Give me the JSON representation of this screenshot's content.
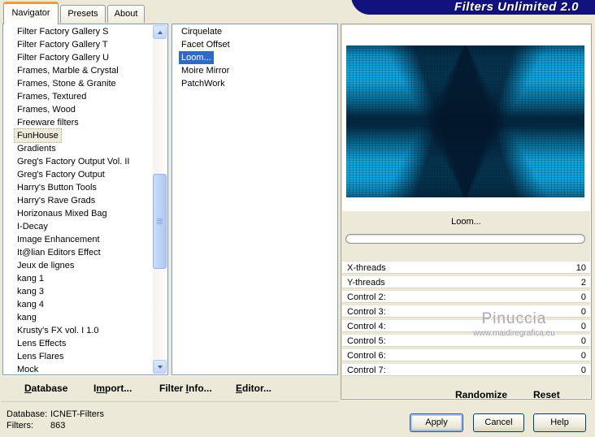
{
  "window": {
    "banner_title": "Filters Unlimited 2.0"
  },
  "tabs": [
    "Navigator",
    "Presets",
    "About"
  ],
  "category_list": {
    "selected_index": 8,
    "items": [
      "Filter Factory Gallery S",
      "Filter Factory Gallery T",
      "Filter Factory Gallery U",
      "Frames, Marble & Crystal",
      "Frames, Stone & Granite",
      "Frames, Textured",
      "Frames, Wood",
      "Freeware filters",
      "FunHouse",
      "Gradients",
      "Greg's Factory Output Vol. II",
      "Greg's Factory Output",
      "Harry's Button Tools",
      "Harry's Rave Grads",
      "Horizonaus Mixed Bag",
      "I-Decay",
      "Image Enhancement",
      "It@lian Editors Effect",
      "Jeux de lignes",
      "kang 1",
      "kang 3",
      "kang 4",
      "kang",
      "Krusty's FX vol. I 1.0",
      "Lens Effects",
      "Lens Flares",
      "Mock"
    ]
  },
  "filter_list": {
    "selected_index": 2,
    "items": [
      "Cirquelate",
      "Facet Offset",
      "Loom...",
      "Moire Mirror",
      "PatchWork"
    ]
  },
  "preview": {
    "caption": "Loom...",
    "progress_percent": 0
  },
  "sliders": [
    {
      "label": "X-threads",
      "value": "10"
    },
    {
      "label": "Y-threads",
      "value": "2"
    },
    {
      "label": "Control 2:",
      "value": "0"
    },
    {
      "label": "Control 3:",
      "value": "0"
    },
    {
      "label": "Control 4:",
      "value": "0"
    },
    {
      "label": "Control 5:",
      "value": "0"
    },
    {
      "label": "Control 6:",
      "value": "0"
    },
    {
      "label": "Control 7:",
      "value": "0"
    }
  ],
  "watermark": {
    "name": "Pinuccia",
    "url": "www.maidiregrafica.eu"
  },
  "command_bar": {
    "database": {
      "pre": "",
      "key": "D",
      "post": "atabase"
    },
    "import": {
      "pre": "I",
      "key": "m",
      "post": "port..."
    },
    "filter_info": {
      "pre": "Filter ",
      "key": "I",
      "post": "nfo..."
    },
    "editor": {
      "pre": "",
      "key": "E",
      "post": "ditor..."
    },
    "randomize": "Randomize",
    "reset": "Reset"
  },
  "status": {
    "database_label": "Database:",
    "database_value": "ICNET-Filters",
    "filters_label": "Filters:",
    "filters_value": "863"
  },
  "action_buttons": {
    "apply": "Apply",
    "cancel": "Cancel",
    "help": "Help"
  },
  "colors": {
    "dialog_bg": "#ECE9D8",
    "selection_blue": "#316AC5",
    "banner_navy": "#12127E",
    "tab_accent_orange": "#F49B38",
    "preview_cyan": "#0CA6DE"
  }
}
